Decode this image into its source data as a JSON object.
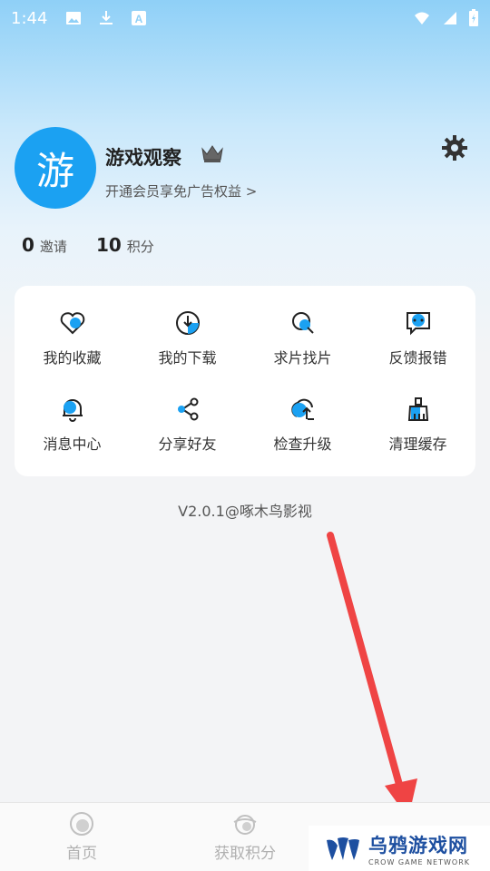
{
  "status_bar": {
    "time": "1:44",
    "icons_left": [
      "image-icon",
      "download-icon",
      "a-badge-icon"
    ],
    "icons_right": [
      "wifi-icon",
      "signal-icon",
      "battery-icon"
    ]
  },
  "profile": {
    "avatar_text": "游",
    "username": "游戏观察",
    "vip_link": "开通会员享免广告权益 >"
  },
  "stats": [
    {
      "value": "0",
      "label": "邀请"
    },
    {
      "value": "10",
      "label": "积分"
    }
  ],
  "menu": [
    {
      "label": "我的收藏",
      "icon": "heart-icon"
    },
    {
      "label": "我的下载",
      "icon": "download-circle-icon"
    },
    {
      "label": "求片找片",
      "icon": "search-icon"
    },
    {
      "label": "反馈报错",
      "icon": "feedback-icon"
    },
    {
      "label": "消息中心",
      "icon": "bell-icon"
    },
    {
      "label": "分享好友",
      "icon": "share-icon"
    },
    {
      "label": "检查升级",
      "icon": "upgrade-icon"
    },
    {
      "label": "清理缓存",
      "icon": "broom-icon"
    }
  ],
  "version": "V2.0.1@啄木鸟影视",
  "tabs": [
    {
      "label": "首页",
      "icon": "home-icon"
    },
    {
      "label": "获取积分",
      "icon": "points-icon"
    },
    {
      "label": "",
      "icon": "me-icon"
    }
  ],
  "watermark": {
    "title": "乌鸦游戏网",
    "subtitle": "CROW GAME NETWORK"
  },
  "colors": {
    "accent": "#1ba1f2",
    "arrow": "#ef4444"
  }
}
